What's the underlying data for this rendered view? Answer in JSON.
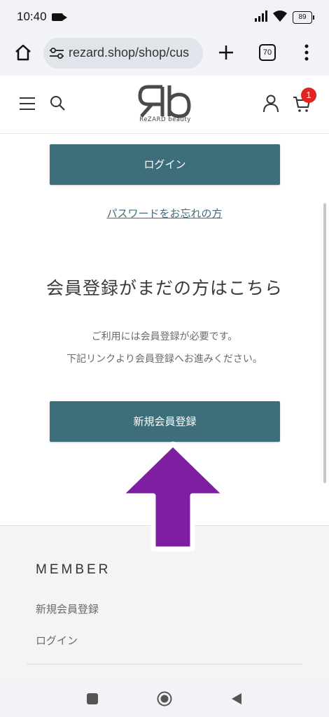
{
  "status_bar": {
    "time": "10:40",
    "battery": "89"
  },
  "browser": {
    "url": "rezard.shop/shop/cus",
    "tab_count": "70"
  },
  "header": {
    "logo_text": "ReZARD beauty",
    "cart_count": "1"
  },
  "main": {
    "login_button": "ログイン",
    "forgot_password_link": "パスワードをお忘れの方",
    "register_heading": "会員登録がまだの方はこちら",
    "register_note_line1": "ご利用には会員登録が必要です。",
    "register_note_line2": "下記リンクより会員登録へお進みください。",
    "register_button": "新規会員登録"
  },
  "footer": {
    "title": "MEMBER",
    "links": [
      "新規会員登録",
      "ログイン"
    ]
  },
  "colors": {
    "button": "#3e6e7b",
    "arrow": "#7d1fa0",
    "badge": "#e02424"
  }
}
